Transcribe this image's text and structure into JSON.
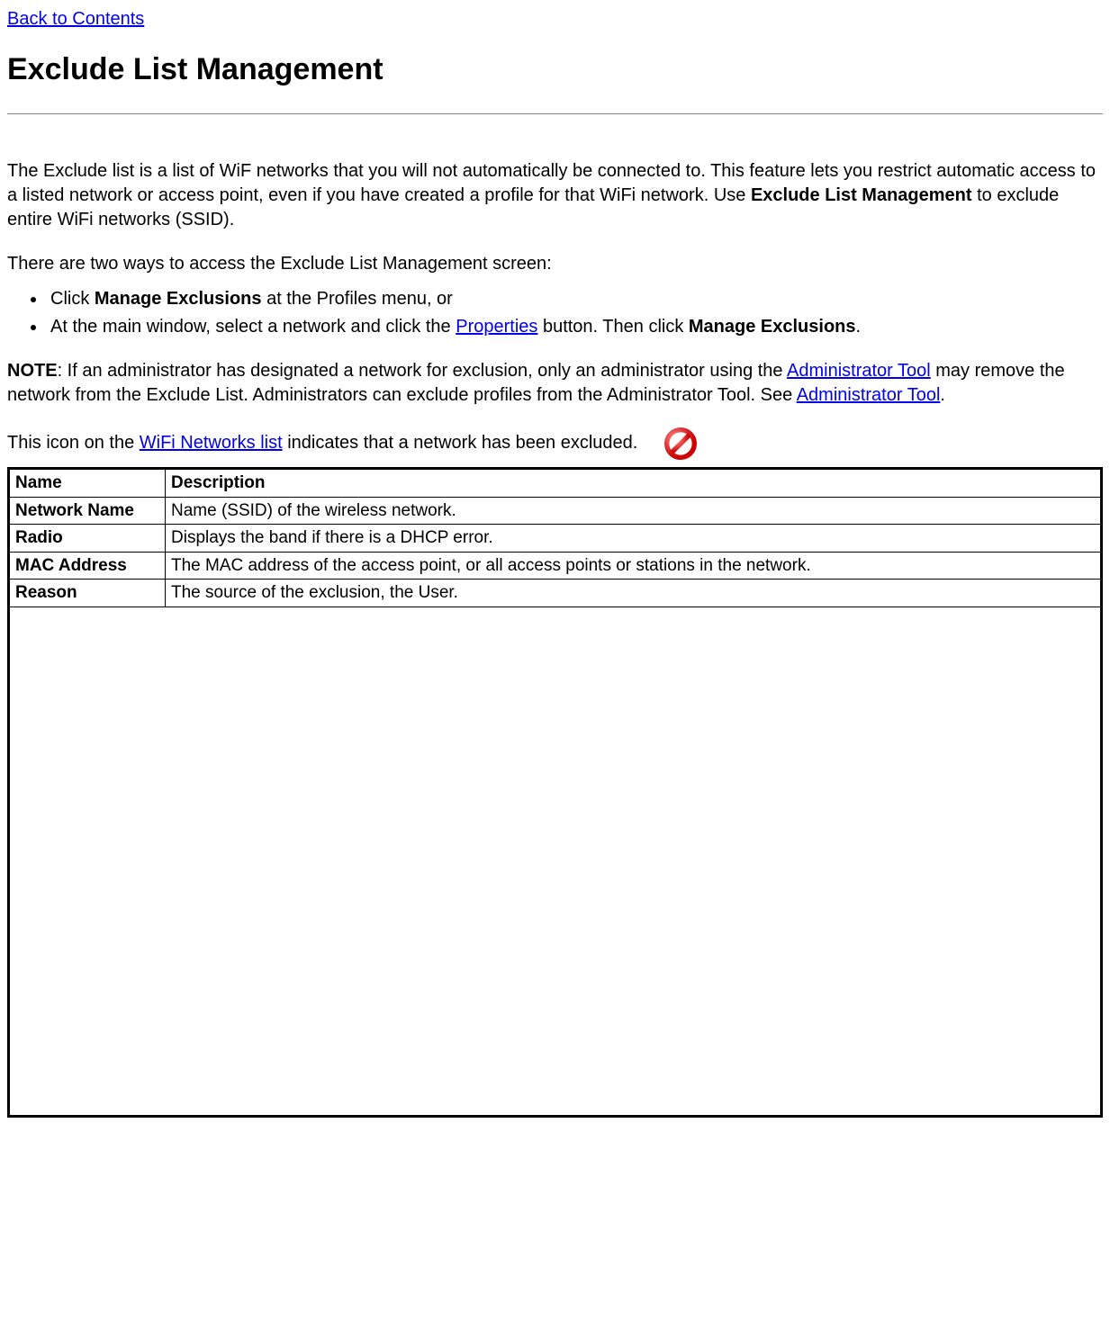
{
  "nav": {
    "back_link": "Back to Contents"
  },
  "heading": "Exclude List Management",
  "intro": {
    "p1_a": "The Exclude list is a list of WiF networks that you will not automatically be connected to. This feature lets you restrict automatic access to a listed network or access point, even if you have created a profile for that WiFi network. Use ",
    "p1_b": "Exclude List Management",
    "p1_c": " to exclude entire WiFi networks (SSID).",
    "p2": "There are two ways to access the Exclude List Management screen:"
  },
  "bullets": {
    "item1_a": "Click ",
    "item1_b": "Manage Exclusions",
    "item1_c": " at the Profiles menu, or",
    "item2_a": "At the main window, select a network and click the ",
    "item2_link": "Properties",
    "item2_b": " button. Then click ",
    "item2_c": "Manage Exclusions",
    "item2_d": "."
  },
  "note": {
    "label": "NOTE",
    "text_a": ": If an administrator has designated a network for exclusion, only an administrator using the ",
    "link1": "Administrator Tool",
    "text_b": " may remove the network from the Exclude List. Administrators can exclude profiles from the Administrator Tool. See ",
    "link2": "Administrator Tool",
    "text_c": "."
  },
  "icon_line": {
    "text_a": "This icon on the ",
    "link": "WiFi Networks list",
    "text_b": " indicates that a network has been excluded."
  },
  "table": {
    "headers": {
      "name": "Name",
      "desc": "Description"
    },
    "rows": [
      {
        "name": "Network Name",
        "desc": "Name (SSID) of the wireless network."
      },
      {
        "name": "Radio",
        "desc": "Displays the band if there is a DHCP error."
      },
      {
        "name": "MAC Address",
        "desc": "The MAC address of the access point, or all access points or stations in the network."
      },
      {
        "name": "Reason",
        "desc": "The source of the exclusion, the User."
      }
    ]
  }
}
